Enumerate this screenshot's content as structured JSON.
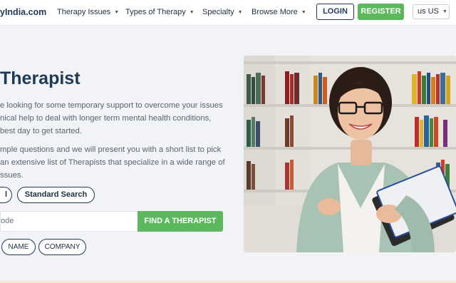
{
  "header": {
    "logo": "yIndia.com",
    "nav": [
      {
        "label": "Therapy Issues"
      },
      {
        "label": "Types of Therapy"
      },
      {
        "label": "Specialty"
      },
      {
        "label": "Browse More"
      }
    ],
    "login": "LOGIN",
    "register": "REGISTER",
    "locale": "us US"
  },
  "hero": {
    "title": "Therapist",
    "para1": [
      "e looking for some temporary support to overcome your issues",
      "nical help to deal with longer term mental health conditions,",
      "best day to get started."
    ],
    "para2": [
      "mple questions and we will present you with a short list to pick",
      "an extensive list of Therapists that specialize in a wide range of",
      "ssues."
    ],
    "search_mode_left": "l",
    "search_mode_std": "Standard Search",
    "search_placeholder": "ode",
    "find_button": "FIND A THERAPIST",
    "filter_name": "NAME",
    "filter_company": "COMPANY"
  },
  "colors": {
    "brand_navy": "#1f3a56",
    "accent_green": "#5cb85c",
    "page_bg": "#f1f3f6"
  }
}
